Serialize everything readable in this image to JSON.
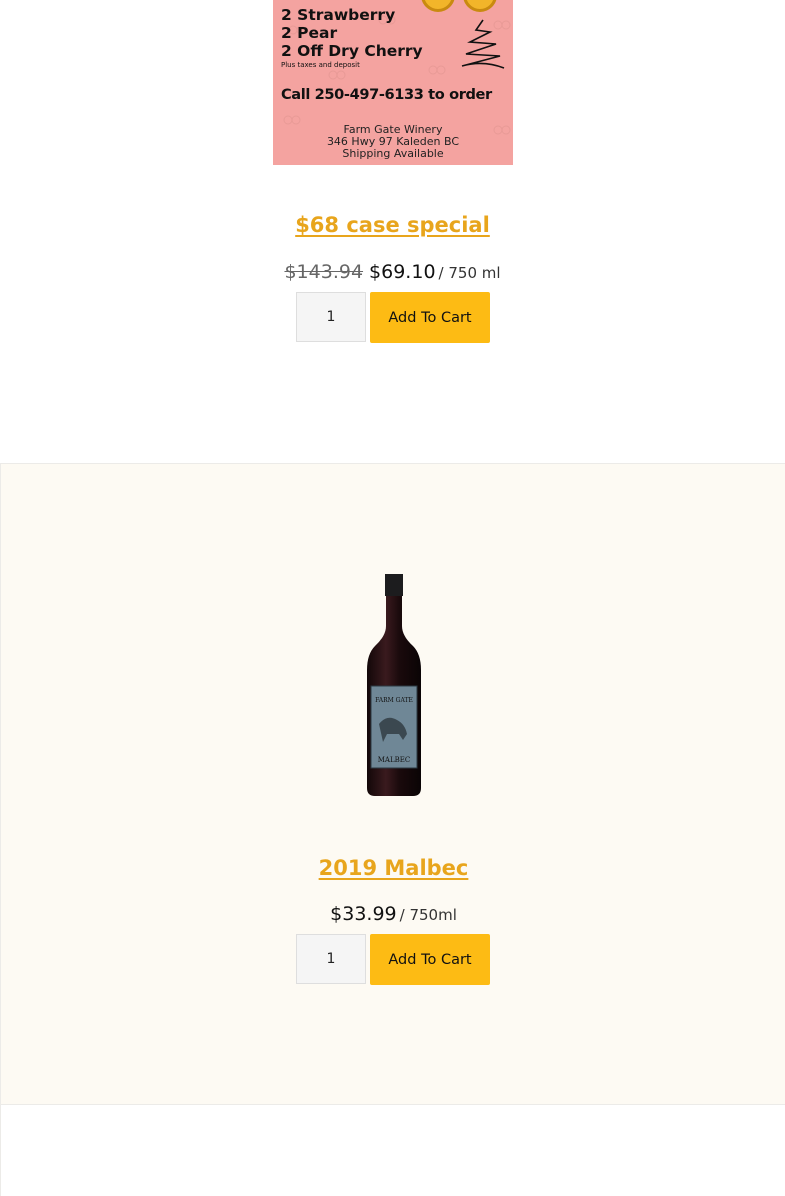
{
  "products": [
    {
      "promo": {
        "line1": "2 Strawberry",
        "line2": "2 Pear",
        "line3": "2 Off Dry Cherry",
        "line4": "Plus taxes and deposit",
        "call": "Call 250-497-6133 to order",
        "address1": "Farm Gate Winery",
        "address2": "346 Hwy 97 Kaleden BC",
        "address3": "Shipping Available"
      },
      "title": "$68 case special",
      "old_price": "$143.94",
      "price": "$69.10",
      "unit": "/ 750 ml",
      "quantity": "1",
      "cart_label": "Add To Cart"
    },
    {
      "title": "2019 Malbec",
      "price": "$33.99",
      "unit": "/ 750ml",
      "quantity": "1",
      "cart_label": "Add To Cart",
      "label_brand": "FARM GATE",
      "label_variety": "MALBEC"
    }
  ],
  "colors": {
    "accent": "#e8a51c",
    "button": "#fdbb14",
    "promo_bg": "#f4a3a0",
    "alt_card_bg": "#fdfaf3"
  }
}
